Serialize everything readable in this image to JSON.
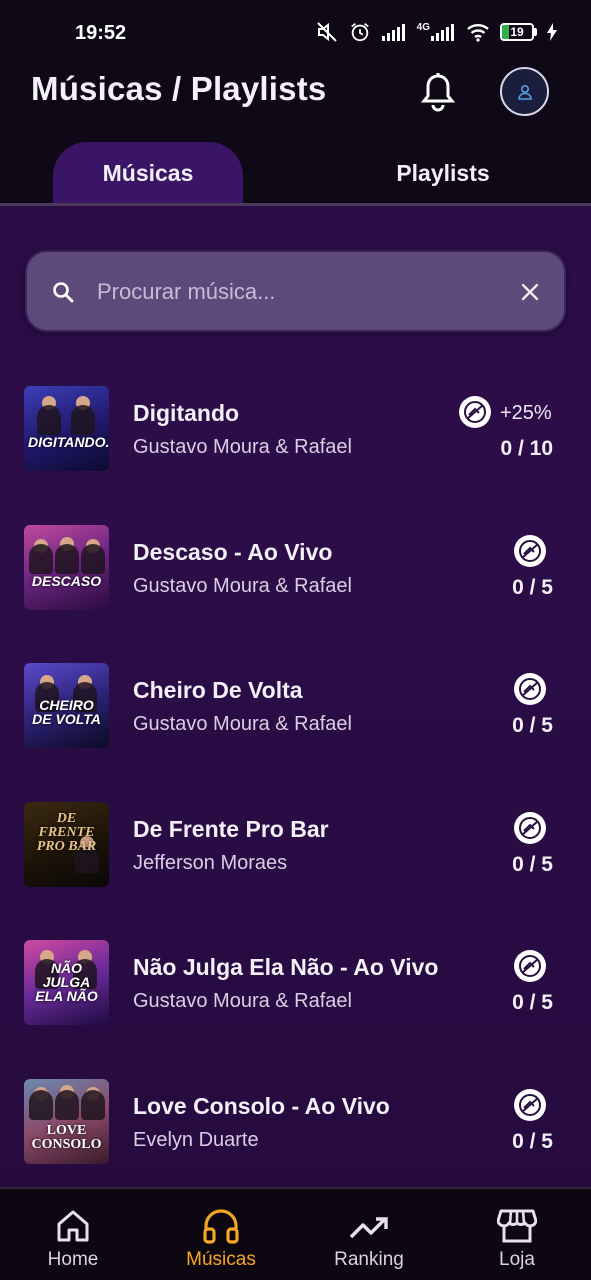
{
  "status_bar": {
    "time": "19:52",
    "battery": "19",
    "network": "4G"
  },
  "header": {
    "title": "Músicas / Playlists"
  },
  "tabs": [
    {
      "label": "Músicas",
      "active": true
    },
    {
      "label": "Playlists",
      "active": false
    }
  ],
  "search": {
    "placeholder": "Procurar música...",
    "value": ""
  },
  "songs": [
    {
      "title": "Digitando",
      "artist": "Gustavo Moura & Rafael",
      "cover_text": "DIGITANDO...",
      "bonus": "+25%",
      "score": "0 / 10"
    },
    {
      "title": "Descaso - Ao Vivo",
      "artist": "Gustavo Moura & Rafael",
      "cover_text": "DESCASO",
      "bonus": "",
      "score": "0 / 5"
    },
    {
      "title": "Cheiro De Volta",
      "artist": "Gustavo Moura & Rafael",
      "cover_text": "CHEIRO DE VOLTA",
      "bonus": "",
      "score": "0 / 5"
    },
    {
      "title": "De Frente Pro Bar",
      "artist": "Jefferson Moraes",
      "cover_text": "DE FRENTE PRO BAR",
      "bonus": "",
      "score": "0 / 5"
    },
    {
      "title": "Não Julga Ela Não - Ao Vivo",
      "artist": "Gustavo Moura & Rafael",
      "cover_text": "NÃO JULGA ELA NÃO",
      "bonus": "",
      "score": "0 / 5"
    },
    {
      "title": "Love Consolo - Ao Vivo",
      "artist": "Evelyn Duarte",
      "cover_text": "LOVE CONSOLO",
      "bonus": "",
      "score": "0 / 5"
    }
  ],
  "bottom_nav": [
    {
      "label": "Home",
      "icon": "home-icon",
      "active": false
    },
    {
      "label": "Músicas",
      "icon": "headphones-icon",
      "active": true
    },
    {
      "label": "Ranking",
      "icon": "trending-up-icon",
      "active": false
    },
    {
      "label": "Loja",
      "icon": "store-icon",
      "active": false
    }
  ],
  "colors": {
    "accent": "#f5a623",
    "background": "#2a0c46",
    "header": "#0f0816",
    "tab_active": "#3a1566",
    "search_bg": "#5d4a7a"
  }
}
